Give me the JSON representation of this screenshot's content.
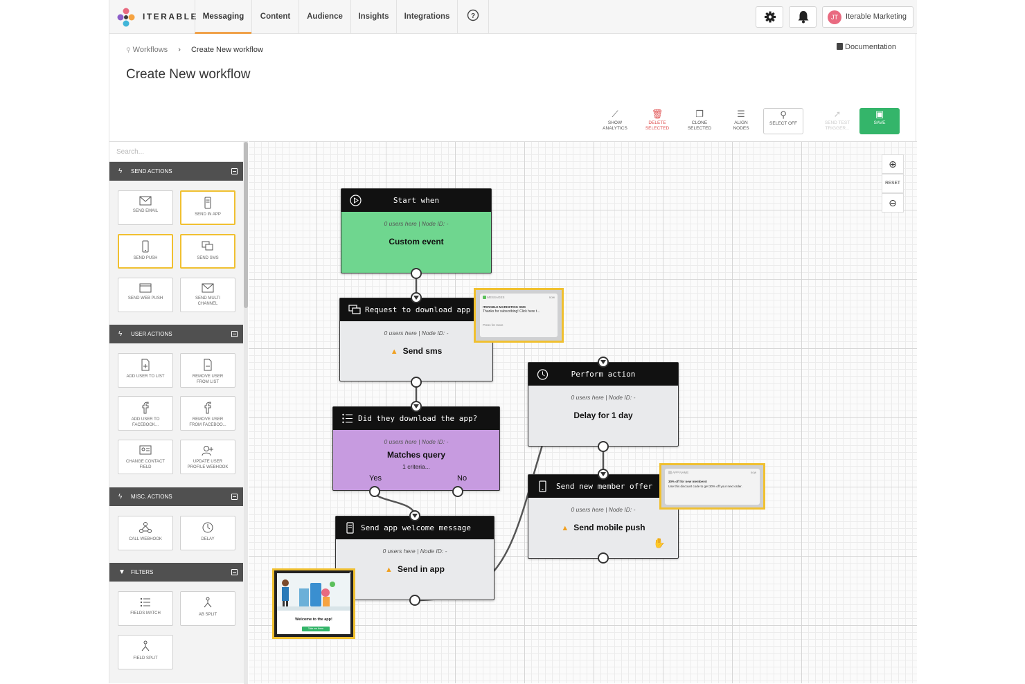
{
  "brand": "ITERABLE",
  "nav": {
    "tabs": [
      "Messaging",
      "Content",
      "Audience",
      "Insights",
      "Integrations"
    ],
    "active": "Messaging",
    "help_icon": "help-circle-icon",
    "settings_icon": "gear-icon",
    "notifications_icon": "bell-icon",
    "user_initials": "JT",
    "user_name": "Iterable Marketing"
  },
  "breadcrumb": {
    "parent": "Workflows",
    "current": "Create New workflow"
  },
  "documentation": "Documentation",
  "page_title": "Create New workflow",
  "toolbar": [
    {
      "label1": "SHOW",
      "label2": "ANALYTICS"
    },
    {
      "label1": "DELETE",
      "label2": "SELECTED"
    },
    {
      "label1": "CLONE",
      "label2": "SELECTED"
    },
    {
      "label1": "ALIGN",
      "label2": "NODES"
    },
    {
      "label1": "SELECT OFF",
      "label2": ""
    },
    {
      "label1": "SEND TEST",
      "label2": "TRIGGER..."
    },
    {
      "label1": "SAVE",
      "label2": ""
    }
  ],
  "sidebar": {
    "search_placeholder": "Search...",
    "sections": [
      {
        "title": "SEND ACTIONS",
        "tiles": [
          {
            "l1": "SEND EMAIL",
            "l2": ""
          },
          {
            "l1": "SEND IN APP",
            "l2": ""
          },
          {
            "l1": "SEND PUSH",
            "l2": ""
          },
          {
            "l1": "SEND SMS",
            "l2": ""
          },
          {
            "l1": "SEND WEB PUSH",
            "l2": ""
          },
          {
            "l1": "SEND MULTI",
            "l2": "CHANNEL"
          }
        ]
      },
      {
        "title": "USER ACTIONS",
        "tiles": [
          {
            "l1": "ADD USER TO LIST",
            "l2": ""
          },
          {
            "l1": "REMOVE USER",
            "l2": "FROM LIST"
          },
          {
            "l1": "ADD USER TO",
            "l2": "FACEBOOK..."
          },
          {
            "l1": "REMOVE USER",
            "l2": "FROM FACEBOO..."
          },
          {
            "l1": "CHANGE CONTACT",
            "l2": "FIELD"
          },
          {
            "l1": "UPDATE USER",
            "l2": "PROFILE WEBHOOK"
          }
        ]
      },
      {
        "title": "MISC. ACTIONS",
        "tiles": [
          {
            "l1": "CALL WEBHOOK",
            "l2": ""
          },
          {
            "l1": "DELAY",
            "l2": ""
          }
        ]
      },
      {
        "title": "FILTERS",
        "tiles": [
          {
            "l1": "FIELDS MATCH",
            "l2": ""
          },
          {
            "l1": "AB SPLIT",
            "l2": ""
          },
          {
            "l1": "FIELD SPLIT",
            "l2": ""
          }
        ]
      }
    ]
  },
  "canvas": {
    "zoom_reset": "RESET",
    "nodes": {
      "start": {
        "header": "Start when",
        "meta": "0 users here | Node ID: -",
        "title": "Custom event"
      },
      "sms": {
        "header": "Request to download app",
        "meta": "0 users here | Node ID: -",
        "title": "Send sms"
      },
      "query": {
        "header": "Did they download the app?",
        "meta": "0 users here | Node ID: -",
        "title": "Matches query",
        "sub": "1 criteria...",
        "yes": "Yes",
        "no": "No"
      },
      "inapp": {
        "header": "Send app welcome message",
        "meta": "0 users here | Node ID: -",
        "title": "Send in app"
      },
      "delay": {
        "header": "Perform action",
        "meta": "0 users here | Node ID: -",
        "title": "Delay for 1 day"
      },
      "push": {
        "header": "Send new member offer",
        "meta": "0 users here | Node ID: -",
        "title": "Send mobile push"
      }
    },
    "sms_preview": {
      "app": "MESSAGES",
      "time": "now",
      "sender": "ITERABLE MARKETING SMS",
      "body": "Thanks for subscribing! Click here t...",
      "footer": "Press for more"
    },
    "push_preview": {
      "app": "APP NAME",
      "time": "now",
      "title": "30% off for new members!",
      "body": "Use this discount code to get 30% off your next order."
    },
    "inapp_preview": {
      "title": "Welcome to the app!",
      "button": "Take me there"
    }
  },
  "colors": {
    "start_green": "#6fd68f",
    "query_purple": "#c79be0",
    "highlight_yellow": "#f0c030",
    "save_green": "#34b56a",
    "active_tab_orange": "#f0a24a"
  }
}
